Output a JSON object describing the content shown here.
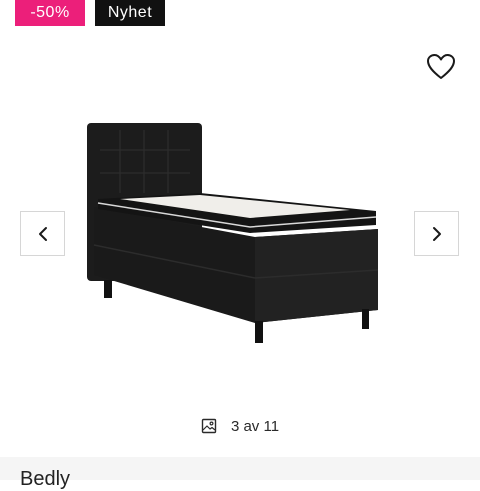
{
  "badges": {
    "discount": "-50%",
    "new": "Nyhet"
  },
  "colors": {
    "discount_badge": "#ec1f7a",
    "new_badge": "#111111",
    "bed": "#1c1c1c"
  },
  "icons": {
    "favorite": "heart-icon",
    "prev": "chevron-left-icon",
    "next": "chevron-right-icon",
    "gallery": "image-icon"
  },
  "gallery": {
    "counter": "3 av 11"
  },
  "product": {
    "brand": "Bedly"
  }
}
